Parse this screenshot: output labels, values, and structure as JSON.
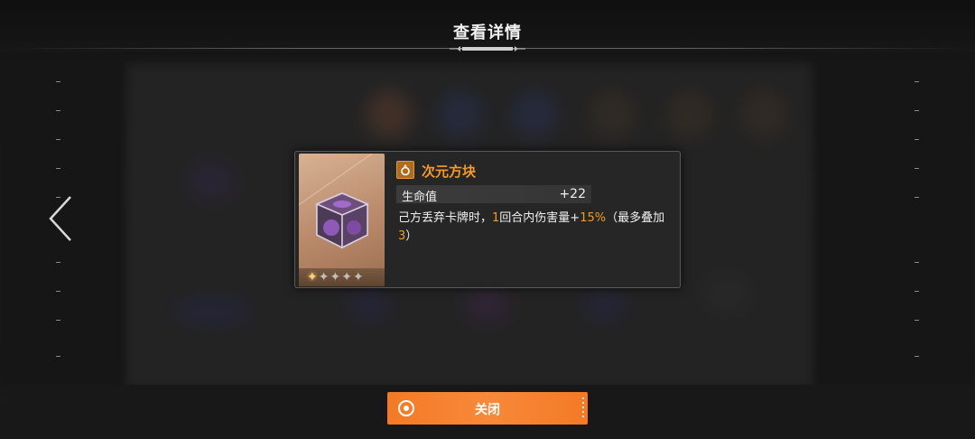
{
  "header": {
    "title": "查看详情"
  },
  "item": {
    "name": "次元方块",
    "icon": "ring-icon",
    "rarity_stars_total": 5,
    "rarity_stars_filled": 1,
    "stat": {
      "label": "生命值",
      "value": "+22"
    },
    "description": {
      "part1": "己方丢弃卡牌时，",
      "highlight1": "1",
      "part2": "回合内伤害量+",
      "highlight2": "15%",
      "part3": "（最多叠加",
      "highlight3": "3",
      "part4": "）"
    }
  },
  "buttons": {
    "close_label": "关闭",
    "prev_icon": "chevron-left-icon"
  },
  "colors": {
    "accent": "#f29b2a",
    "button": "#f37a26",
    "card_bg": "#262626"
  }
}
